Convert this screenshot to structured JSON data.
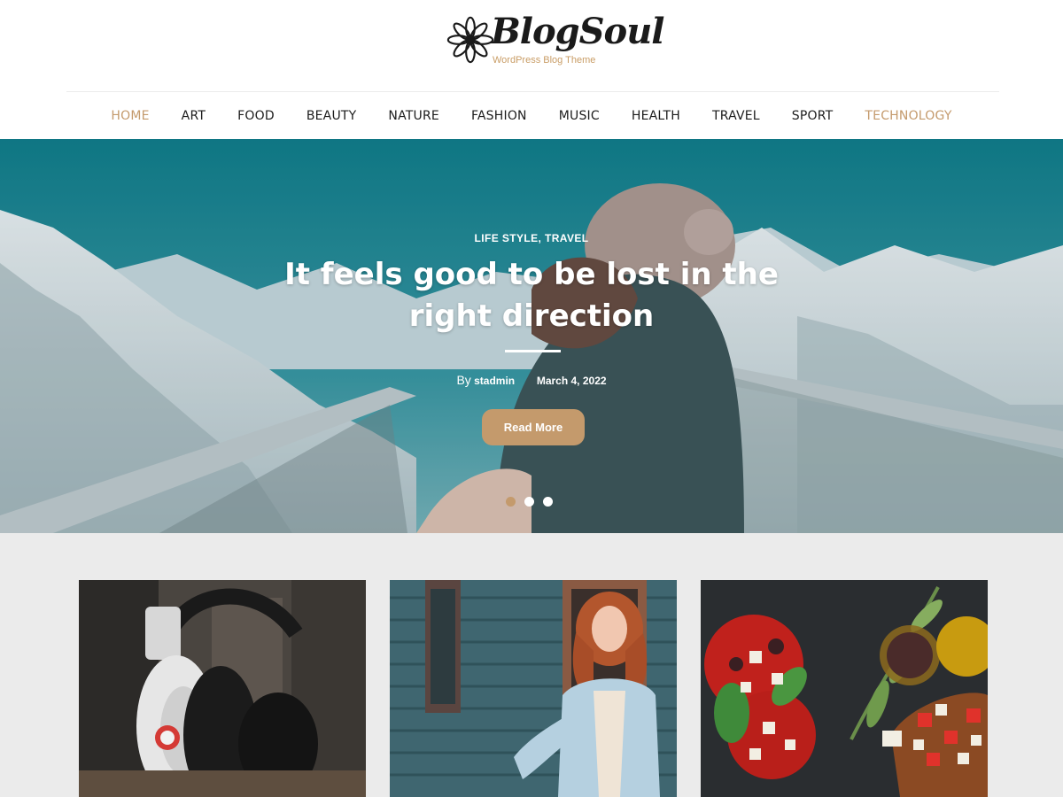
{
  "brand": {
    "name": "BlogSoul",
    "tagline": "WordPress Blog Theme"
  },
  "nav": {
    "items": [
      {
        "label": "HOME",
        "accent": true
      },
      {
        "label": "ART",
        "accent": false
      },
      {
        "label": "FOOD",
        "accent": false
      },
      {
        "label": "BEAUTY",
        "accent": false
      },
      {
        "label": "NATURE",
        "accent": false
      },
      {
        "label": "FASHION",
        "accent": false
      },
      {
        "label": "MUSIC",
        "accent": false
      },
      {
        "label": "HEALTH",
        "accent": false
      },
      {
        "label": "TRAVEL",
        "accent": false
      },
      {
        "label": "SPORT",
        "accent": false
      },
      {
        "label": "TECHNOLOGY",
        "accent": true
      }
    ]
  },
  "hero": {
    "categories": "LIFE STYLE, TRAVEL",
    "title": "It feels good to be lost in the right direction",
    "by_label": "By",
    "author": "stadmin",
    "date": "March 4, 2022",
    "read_more": "Read More",
    "slide_count": 3,
    "active_slide": 1
  },
  "posts": [
    {
      "image": "headphones-photo"
    },
    {
      "image": "woman-denim-jacket-photo"
    },
    {
      "image": "bruschetta-food-photo"
    }
  ],
  "colors": {
    "accent": "#c49a6c",
    "nav_text": "#1c1c1c",
    "posts_background": "#ebebeb"
  }
}
